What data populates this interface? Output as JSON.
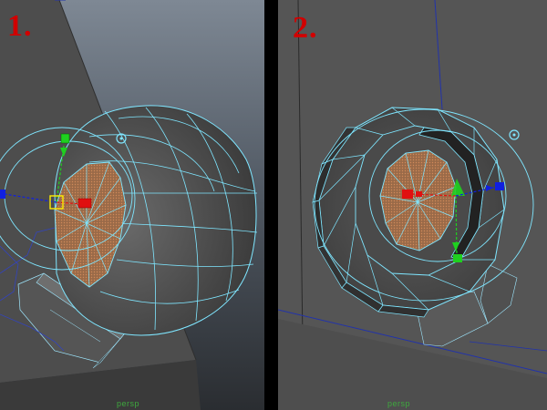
{
  "panels": [
    {
      "number": "1.",
      "camera": "persp"
    },
    {
      "number": "2.",
      "camera": "persp"
    }
  ],
  "colors": {
    "viewport_bg": "#4f4f4f",
    "wire": "#7fe6ff",
    "face_fill": "#b07a52",
    "panel_number": "#d10000",
    "camera_label": "#3ea83e",
    "axis_x": "#e01010",
    "axis_y": "#1fd01f",
    "axis_z": "#1020e0"
  },
  "icons": [
    "move-manipulator-icon",
    "pivot-point-icon"
  ]
}
